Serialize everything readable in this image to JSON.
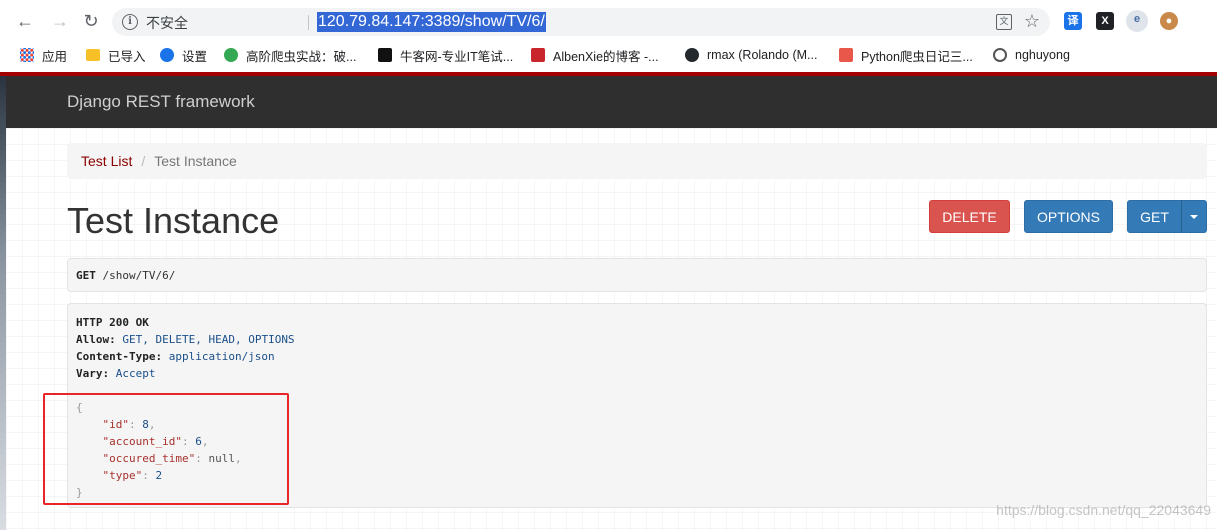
{
  "browser": {
    "security_label": "不安全",
    "url": "120.79.84.147:3389/show/TV/6/"
  },
  "bookmarks": [
    {
      "label": "应用",
      "icon": "apps-grid-icon",
      "color": "#e94235"
    },
    {
      "label": "已导入",
      "icon": "folder-icon",
      "color": "#f6c026"
    },
    {
      "label": "设置",
      "icon": "gear-icon",
      "color": "#1a73e8"
    },
    {
      "label": "高阶爬虫实战：破...",
      "icon": "c-logo-icon",
      "color": "#35a853"
    },
    {
      "label": "牛客网-专业IT笔试...",
      "icon": "nowcoder-icon",
      "color": "#111111"
    },
    {
      "label": "AlbenXie的博客 -...",
      "icon": "csdn-c-icon",
      "color": "#c9252c"
    },
    {
      "label": "rmax (Rolando (M...",
      "icon": "github-icon",
      "color": "#24292e"
    },
    {
      "label": "Python爬虫日记三...",
      "icon": "jian-icon",
      "color": "#e9574b"
    },
    {
      "label": "nghuyong",
      "icon": "globe-icon",
      "color": "#555555"
    }
  ],
  "app": {
    "brand": "Django REST framework"
  },
  "breadcrumb": {
    "link": "Test List",
    "separator": "/",
    "active": "Test Instance"
  },
  "page": {
    "title": "Test Instance"
  },
  "buttons": {
    "delete": "DELETE",
    "options": "OPTIONS",
    "get": "GET"
  },
  "request": {
    "method": "GET",
    "path": " /show/TV/6/"
  },
  "response": {
    "status_line": "HTTP 200 OK",
    "headers": [
      {
        "name": "Allow:",
        "value": " GET, DELETE, HEAD, OPTIONS"
      },
      {
        "name": "Content-Type:",
        "value": " application/json"
      },
      {
        "name": "Vary:",
        "value": " Accept"
      }
    ],
    "json_open": "{",
    "json_close": "}",
    "fields": [
      {
        "key": "\"id\"",
        "value": "8",
        "type": "num",
        "comma": ","
      },
      {
        "key": "\"account_id\"",
        "value": "6",
        "type": "num",
        "comma": ","
      },
      {
        "key": "\"occured_time\"",
        "value": "null",
        "type": "null",
        "comma": ","
      },
      {
        "key": "\"type\"",
        "value": "2",
        "type": "num",
        "comma": ""
      }
    ]
  },
  "watermark": "https://blog.csdn.net/qq_22043649"
}
